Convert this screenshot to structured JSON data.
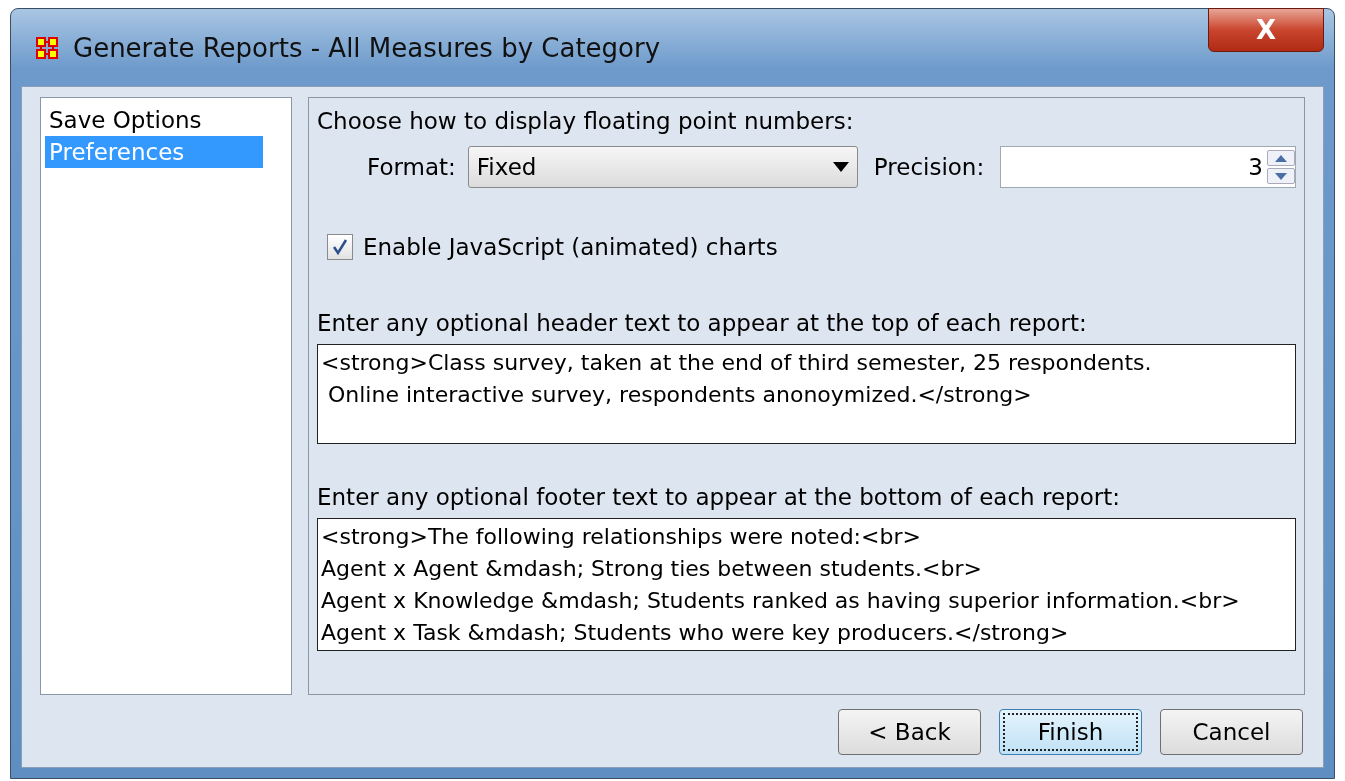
{
  "window": {
    "title": "Generate Reports - All Measures by Category",
    "close": "X"
  },
  "sidebar": {
    "items": [
      {
        "label": "Save Options",
        "selected": false
      },
      {
        "label": "Preferences",
        "selected": true
      }
    ]
  },
  "preferences": {
    "intro": "Choose how to display floating point numbers:",
    "format": {
      "label": "Format:",
      "value": "Fixed"
    },
    "precision": {
      "label": "Precision:",
      "value": "3"
    },
    "javascript_charts": {
      "label": "Enable JavaScript (animated) charts",
      "checked": true
    },
    "header": {
      "label": "Enter any optional header text to appear at the top of each report:",
      "lines": [
        "<strong>Class survey, taken at the end of third semester, 25 respondents.",
        " Online interactive survey, respondents anonoymized.</strong>"
      ]
    },
    "footer": {
      "label": "Enter any optional footer text to appear at the bottom of each report:",
      "lines": [
        "<strong>The following relationships were noted:<br>",
        "Agent x Agent &mdash; Strong ties between students.<br>",
        "Agent x Knowledge &mdash; Students ranked as having superior information.<br>",
        "Agent x Task &mdash; Students who were key producers.</strong>"
      ]
    }
  },
  "buttons": [
    {
      "label": "< Back",
      "focused": false
    },
    {
      "label": "Finish",
      "focused": true
    },
    {
      "label": "Cancel",
      "focused": false
    }
  ]
}
